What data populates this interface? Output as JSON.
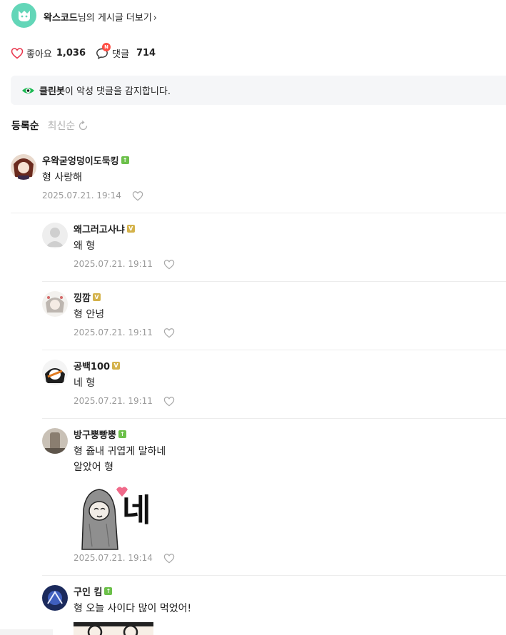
{
  "header": {
    "cafe_name": "왁스코드",
    "title_suffix": "님의 게시글 더보기",
    "chevron": "›",
    "logo_icon": "cafe-logo-icon",
    "brand_color": "#63d6b8"
  },
  "stats": {
    "like_label": "좋아요",
    "like_count": "1,036",
    "comment_label": "댓글",
    "comment_count": "714",
    "new_badge": "N"
  },
  "cleanbot": {
    "name": "클린봇",
    "message": "이 악성 댓글을 감지합니다."
  },
  "sort": {
    "options": [
      "등록순",
      "최신순"
    ],
    "active": "등록순"
  },
  "comments": [
    {
      "nickname": "우왁굳엉덩이도둑킹",
      "level_badge": "green",
      "lines": [
        "형 사랑해"
      ],
      "date": "2025.07.21. 19:14",
      "reply": false
    },
    {
      "nickname": "왜그러고사냐",
      "level_badge": "gold",
      "lines": [
        "왜 형"
      ],
      "date": "2025.07.21. 19:11",
      "reply": true
    },
    {
      "nickname": "낑깜",
      "level_badge": "gold",
      "lines": [
        "형 안녕"
      ],
      "date": "2025.07.21. 19:11",
      "reply": true
    },
    {
      "nickname": "공백100",
      "level_badge": "gold",
      "lines": [
        "네 형"
      ],
      "date": "2025.07.21. 19:11",
      "reply": true
    },
    {
      "nickname": "방구뿡빵뿡",
      "level_badge": "green",
      "lines": [
        "형 쥽내 귀엽게 말하네",
        "알았어 형"
      ],
      "sticker": "네",
      "date": "2025.07.21. 19:14",
      "reply": true
    },
    {
      "nickname": "구인 킴",
      "level_badge": "green",
      "lines": [
        "형 오늘 사이다 많이 먹었어!"
      ],
      "reply": true
    }
  ]
}
